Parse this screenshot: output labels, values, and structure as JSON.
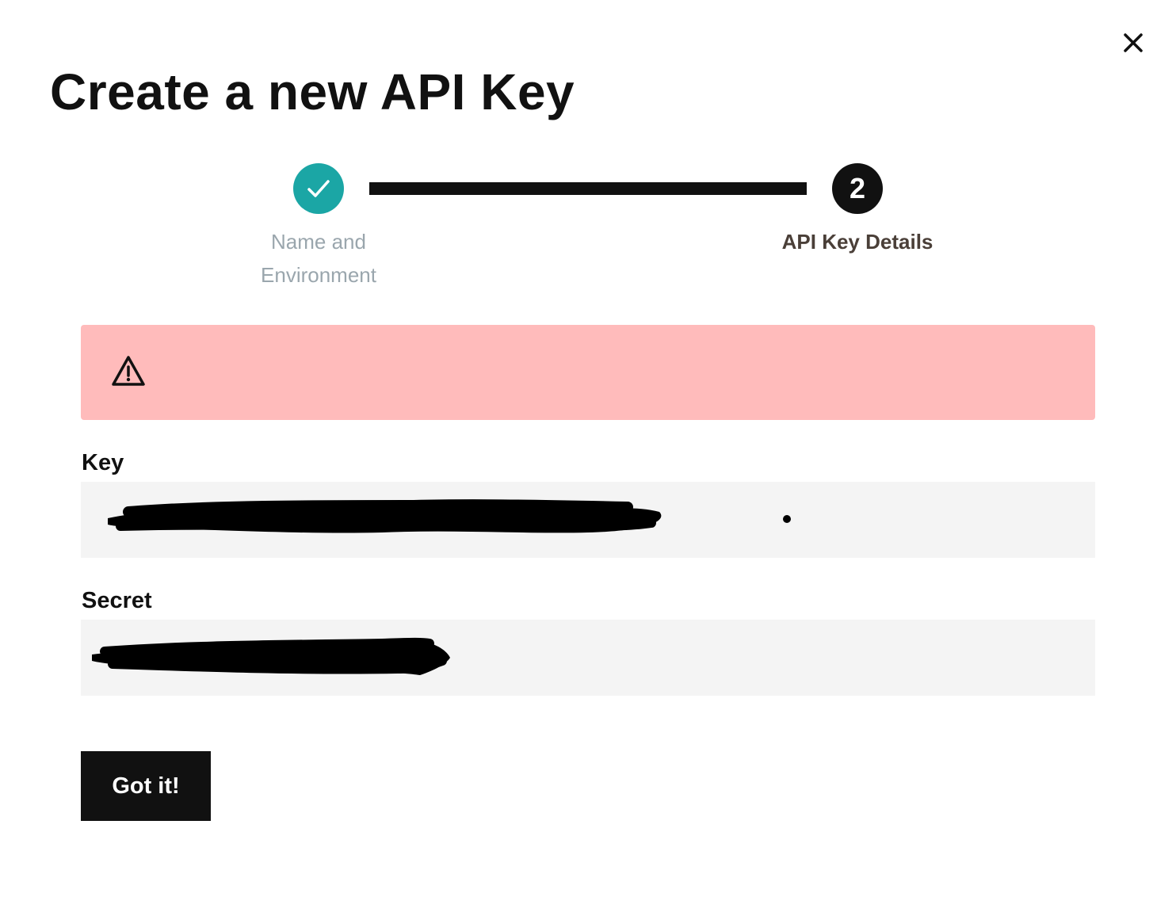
{
  "dialog": {
    "title": "Create a new API Key",
    "close_icon": "close-icon"
  },
  "stepper": {
    "steps": [
      {
        "label": "Name and Environment",
        "state": "completed",
        "icon": "check-icon"
      },
      {
        "label": "API Key Details",
        "state": "active",
        "number": "2"
      }
    ],
    "colors": {
      "completed": "#1ba6a5",
      "active": "#111111",
      "completed_label": "#9aa6ad",
      "active_label": "#4a3f38"
    }
  },
  "warning": {
    "icon": "warning-triangle-icon",
    "text": "",
    "background": "#ffbbbb"
  },
  "fields": {
    "key": {
      "label": "Key",
      "value": "",
      "redacted": true
    },
    "secret": {
      "label": "Secret",
      "value": "",
      "redacted": true
    }
  },
  "actions": {
    "confirm_label": "Got it!"
  }
}
